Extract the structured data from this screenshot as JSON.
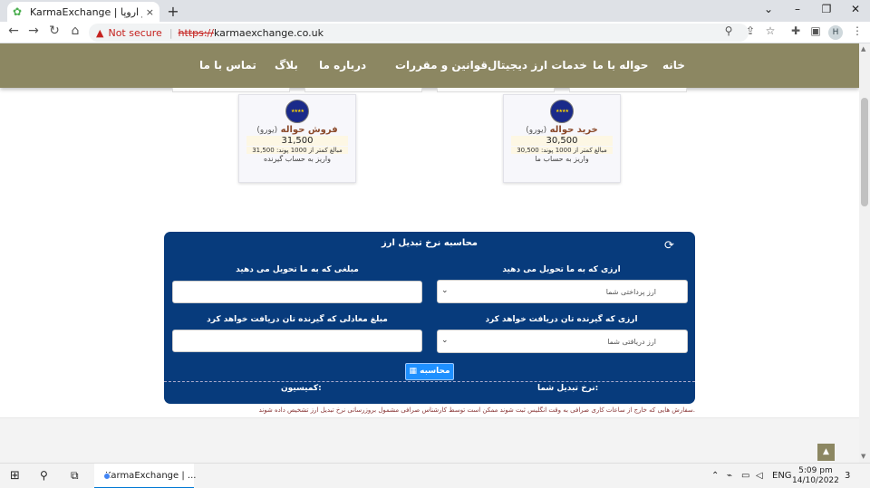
{
  "browser": {
    "tab_title": "KarmaExchange | صرافی در اروپا",
    "new_tab": "+",
    "close_tab": "×",
    "not_secure": "Not secure",
    "url_proto": "https://",
    "url_rest": "karmaexchange.co.uk",
    "profile_initial": "H"
  },
  "nav": {
    "items": [
      "خانه",
      "حواله با ما",
      "خدمات ارز دیجیتال",
      "قوانین و مقررات",
      "درباره ما",
      "بلاگ",
      "تماس با ما"
    ]
  },
  "cards": {
    "sell": {
      "title": "فروش حواله",
      "currency": "(یورو)",
      "rate": "31,500",
      "line": "مبالغ کمتر از 1000 پوند: 31,500",
      "sub": "واریز به حساب گیرنده"
    },
    "buy": {
      "title": "خرید حواله",
      "currency": "(یورو)",
      "rate": "30,500",
      "line": "مبالغ کمتر از 1000 پوند: 30,500",
      "sub": "واریز به حساب ما"
    }
  },
  "calculator": {
    "title": "محاسبه نرخ تبدیل ارز",
    "label_currency_give": "ارزی که به ما تحویل می دهید",
    "label_amount_give": "مبلغی که به ما تحویل می دهید",
    "placeholder_currency_give": "ارز پرداختی شما",
    "label_currency_receive": "ارزی که گیرنده تان دریافت خواهد کرد",
    "label_amount_receive": "مبلغ معادلی که گیرنده تان دریافت خواهد کرد",
    "placeholder_currency_receive": "ارز دریافتی شما",
    "button": "محاسبه",
    "rate_label": "نرخ تبدیل شما:",
    "commission_label": "کمیسیون:"
  },
  "note": "سفارش هایی که خارج از ساعات کاری صرافی به وقت انگلیس ثبت شوند ممکن است توسط کارشناس صرافی مشمول بروزرسانی نرخ تبدیل ارز تشخیص داده شوند.",
  "taskbar": {
    "chrome_label": "KarmaExchange | ...",
    "lang": "ENG",
    "time": "5:09 pm",
    "date": "14/10/2022",
    "notifications": "3"
  }
}
